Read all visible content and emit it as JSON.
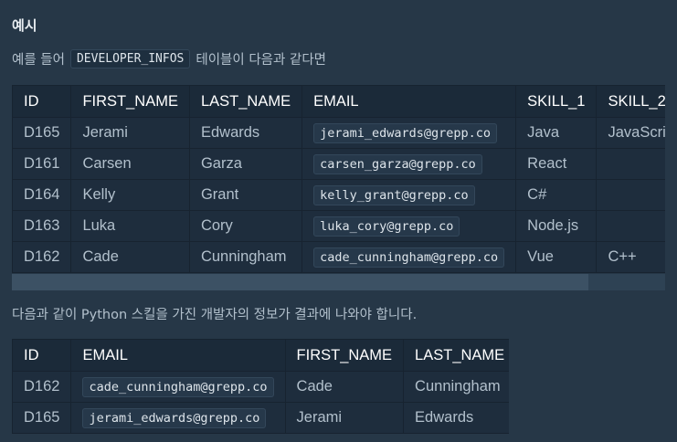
{
  "heading": "예시",
  "intro": {
    "before": "예를 들어",
    "code": "DEVELOPER_INFOS",
    "after": "테이블이 다음과 같다면"
  },
  "table1": {
    "columns": [
      "ID",
      "FIRST_NAME",
      "LAST_NAME",
      "EMAIL",
      "SKILL_1",
      "SKILL_2"
    ],
    "rows": [
      [
        "D165",
        "Jerami",
        "Edwards",
        "jerami_edwards@grepp.co",
        "Java",
        "JavaScript"
      ],
      [
        "D161",
        "Carsen",
        "Garza",
        "carsen_garza@grepp.co",
        "React",
        ""
      ],
      [
        "D164",
        "Kelly",
        "Grant",
        "kelly_grant@grepp.co",
        "C#",
        ""
      ],
      [
        "D163",
        "Luka",
        "Cory",
        "luka_cory@grepp.co",
        "Node.js",
        ""
      ],
      [
        "D162",
        "Cade",
        "Cunningham",
        "cade_cunningham@grepp.co",
        "Vue",
        "C++"
      ]
    ]
  },
  "result_text": "다음과 같이 Python 스킬을 가진 개발자의 정보가 결과에 나와야 합니다.",
  "table2": {
    "columns": [
      "ID",
      "EMAIL",
      "FIRST_NAME",
      "LAST_NAME"
    ],
    "rows": [
      [
        "D162",
        "cade_cunningham@grepp.co",
        "Cade",
        "Cunningham"
      ],
      [
        "D165",
        "jerami_edwards@grepp.co",
        "Jerami",
        "Edwards"
      ]
    ]
  }
}
